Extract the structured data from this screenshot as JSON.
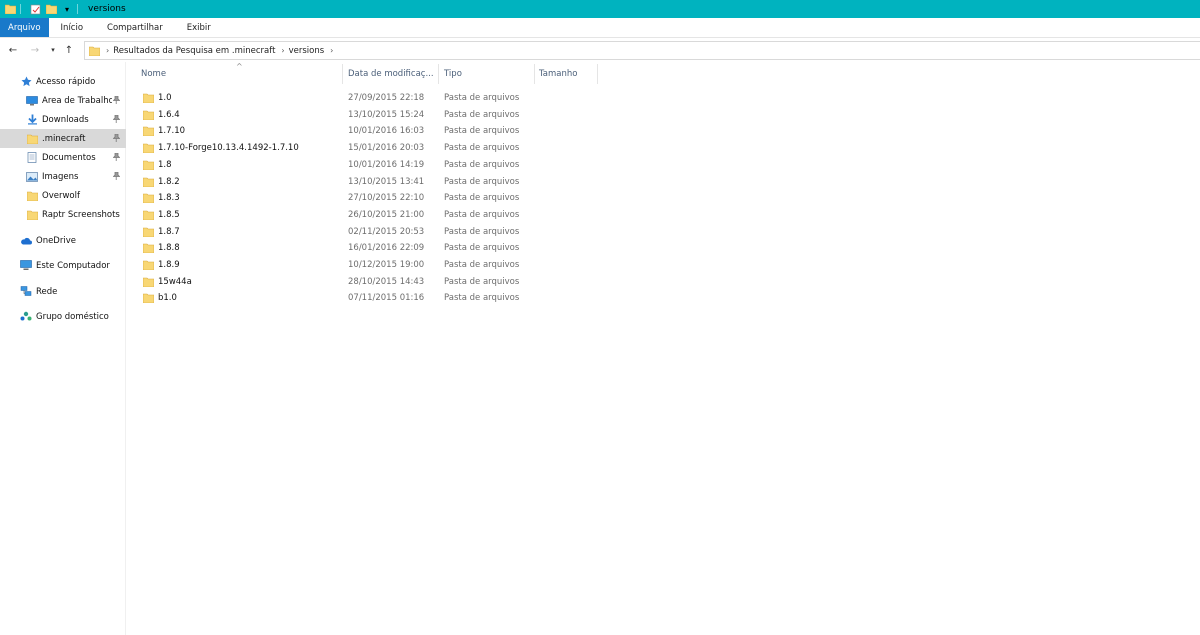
{
  "window": {
    "title": "versions",
    "accent": "#00b3bf"
  },
  "ribbon": {
    "tabs": [
      {
        "label": "Arquivo",
        "active": true
      },
      {
        "label": "Início"
      },
      {
        "label": "Compartilhar"
      },
      {
        "label": "Exibir"
      }
    ]
  },
  "address": {
    "crumbs": [
      "Resultados da Pesquisa em .minecraft",
      "versions"
    ],
    "separator": "›"
  },
  "nav": {
    "items": [
      {
        "label": "Acesso rápido",
        "icon": "star-icon"
      },
      {
        "label": "Área de Trabalho",
        "icon": "desktop-icon",
        "pinned": true
      },
      {
        "label": "Downloads",
        "icon": "download-icon",
        "pinned": true
      },
      {
        "label": ".minecraft",
        "icon": "folder-icon",
        "pinned": true,
        "selected": true
      },
      {
        "label": "Documentos",
        "icon": "document-icon",
        "pinned": true
      },
      {
        "label": "Imagens",
        "icon": "image-icon",
        "pinned": true
      },
      {
        "label": "Overwolf",
        "icon": "folder-icon"
      },
      {
        "label": "Raptr Screenshots",
        "icon": "folder-icon"
      },
      {
        "label": "OneDrive",
        "icon": "cloud-icon"
      },
      {
        "label": "Este Computador",
        "icon": "computer-icon"
      },
      {
        "label": "Rede",
        "icon": "network-icon"
      },
      {
        "label": "Grupo doméstico",
        "icon": "homegroup-icon"
      }
    ],
    "pin_glyph": "📌"
  },
  "columns": {
    "name": "Nome",
    "date": "Data de modificaç...",
    "type": "Tipo",
    "size": "Tamanho"
  },
  "files": [
    {
      "name": "1.0",
      "date": "27/09/2015 22:18",
      "type": "Pasta de arquivos"
    },
    {
      "name": "1.6.4",
      "date": "13/10/2015 15:24",
      "type": "Pasta de arquivos"
    },
    {
      "name": "1.7.10",
      "date": "10/01/2016 16:03",
      "type": "Pasta de arquivos"
    },
    {
      "name": "1.7.10-Forge10.13.4.1492-1.7.10",
      "date": "15/01/2016 20:03",
      "type": "Pasta de arquivos"
    },
    {
      "name": "1.8",
      "date": "10/01/2016 14:19",
      "type": "Pasta de arquivos"
    },
    {
      "name": "1.8.2",
      "date": "13/10/2015 13:41",
      "type": "Pasta de arquivos"
    },
    {
      "name": "1.8.3",
      "date": "27/10/2015 22:10",
      "type": "Pasta de arquivos"
    },
    {
      "name": "1.8.5",
      "date": "26/10/2015 21:00",
      "type": "Pasta de arquivos"
    },
    {
      "name": "1.8.7",
      "date": "02/11/2015 20:53",
      "type": "Pasta de arquivos"
    },
    {
      "name": "1.8.8",
      "date": "16/01/2016 22:09",
      "type": "Pasta de arquivos"
    },
    {
      "name": "1.8.9",
      "date": "10/12/2015 19:00",
      "type": "Pasta de arquivos"
    },
    {
      "name": "15w44a",
      "date": "28/10/2015 14:43",
      "type": "Pasta de arquivos"
    },
    {
      "name": "b1.0",
      "date": "07/11/2015 01:16",
      "type": "Pasta de arquivos"
    }
  ]
}
